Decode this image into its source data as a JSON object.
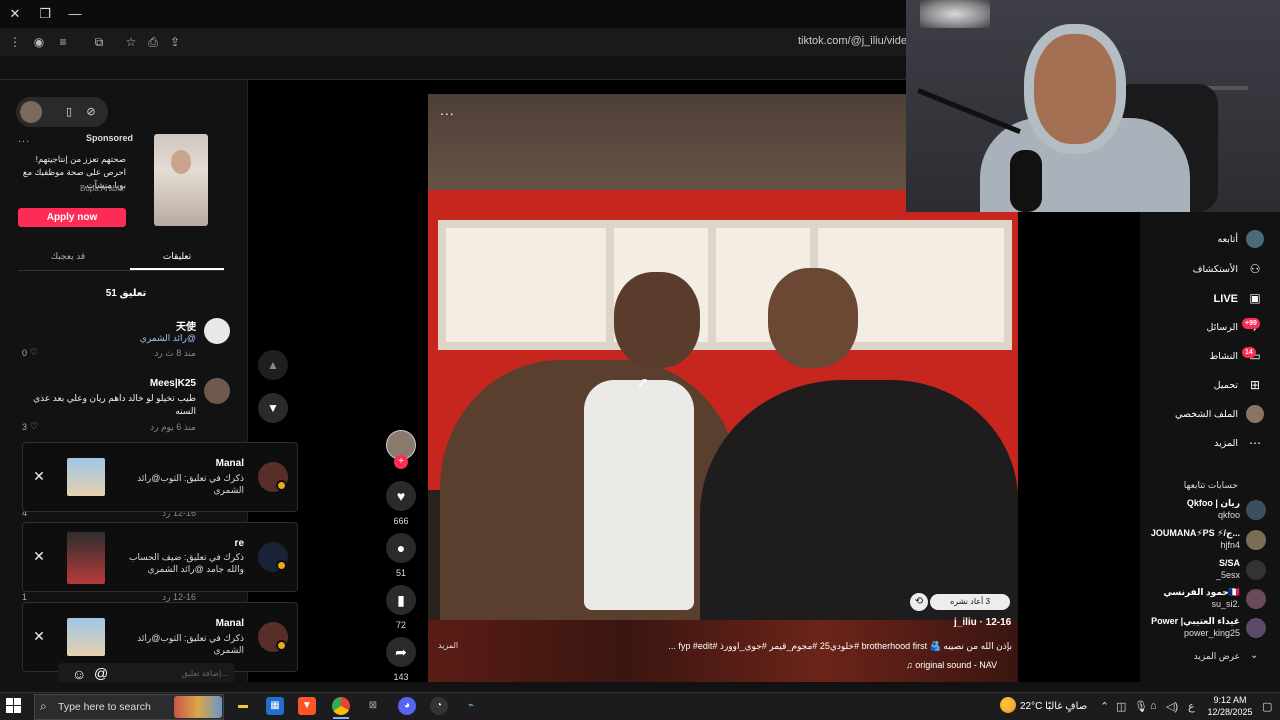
{
  "browser": {
    "url": "tiktok.com/@j_iliu/video/"
  },
  "left_panel": {
    "ad": {
      "dots": "...",
      "sponsored": "Sponsored",
      "text": "صحتهم تعزز من إنتاجيتهم! احرص على صحة موظفيك مع بوبا منشآت.",
      "brand": "Bupa Arabia",
      "cta": "Apply now"
    },
    "tabs": {
      "comments": "تعليقات",
      "related": "قد يعجبك"
    },
    "comment_count": "51 تعليق",
    "comments": [
      {
        "name": "天使",
        "text": "@رائد الشمري",
        "meta": "منذ 8 ث   رد",
        "likes": "0"
      },
      {
        "name": "Mees|K25",
        "text": "طيب تخيلو لو خالد داهم ريان وعلي بعد عذي السنه",
        "meta": "منذ 6 يوم   رد",
        "likes": "3"
      }
    ],
    "hidden_rows": [
      {
        "likes": "4",
        "meta": "12-16   رد"
      },
      {
        "likes": "1",
        "meta": "12-16   رد"
      }
    ]
  },
  "notifications": [
    {
      "title": "Manal",
      "text": "ذكرك في تعليق: التوب@رائد الشمري",
      "close": "✕"
    },
    {
      "title": "re",
      "text": "ذكرك في تعليق: ضيف الحساب والله جامد @رائد الشمري",
      "close": "✕"
    },
    {
      "title": "Manal",
      "text": "ذكرك في تعليق: التوب@رائد الشمري",
      "close": "✕"
    }
  ],
  "comment_input": {
    "placeholder": "إضافة تعليق..."
  },
  "video": {
    "dots": "...",
    "author": "j_iliu · 12-16",
    "repost": "3 أعاد نشره",
    "caption": "بإذن الله من نصيبه 🫂 brotherhood first  #خلودي25 #مجوم_قيمر #جوي_اوورذ #fyp #edit ...",
    "more": "المزيد",
    "sound": "♫ original sound - NAV"
  },
  "actions": {
    "likes": "666",
    "comments": "51",
    "saves": "72",
    "shares": "143"
  },
  "right_sidebar": {
    "items": [
      {
        "label": "أتابعه",
        "icon": "friends-icon"
      },
      {
        "label": "الأستكشاف",
        "icon": "explore-icon"
      },
      {
        "label": "LIVE",
        "icon": "live-icon"
      },
      {
        "label": "الرسائل",
        "icon": "messages-icon",
        "badge": "+99"
      },
      {
        "label": "النشاط",
        "icon": "activity-icon",
        "badge": "14"
      },
      {
        "label": "تحميل",
        "icon": "upload-icon"
      },
      {
        "label": "الملف الشخصي",
        "icon": "profile-icon"
      },
      {
        "label": "المزيد",
        "icon": "more-icon"
      }
    ],
    "following_title": "حسابات تتابعها",
    "accounts": [
      {
        "name": "Qkfoo | ريان",
        "handle": "qkfoo"
      },
      {
        "name": "JOUMANA⚡PS ⚡/ج...",
        "handle": "hjfn4"
      },
      {
        "name": "S/SA",
        "handle": "_5esx"
      },
      {
        "name": "حمود الفرنسي🇫🇷",
        "handle": "su_si2."
      },
      {
        "name": "Power |غيداء العتيبي",
        "handle": "power_king25"
      }
    ],
    "show_more": "عرض المزيد"
  },
  "taskbar": {
    "search_placeholder": "Type here to search",
    "weather": "22°C  صافٍ غالبًا",
    "lang": "ع",
    "time": "9:12 AM",
    "date": "12/28/2025"
  },
  "colors": {
    "accent": "#fe2c55",
    "background": "#121212",
    "badge_orange": "#f0a51e"
  }
}
